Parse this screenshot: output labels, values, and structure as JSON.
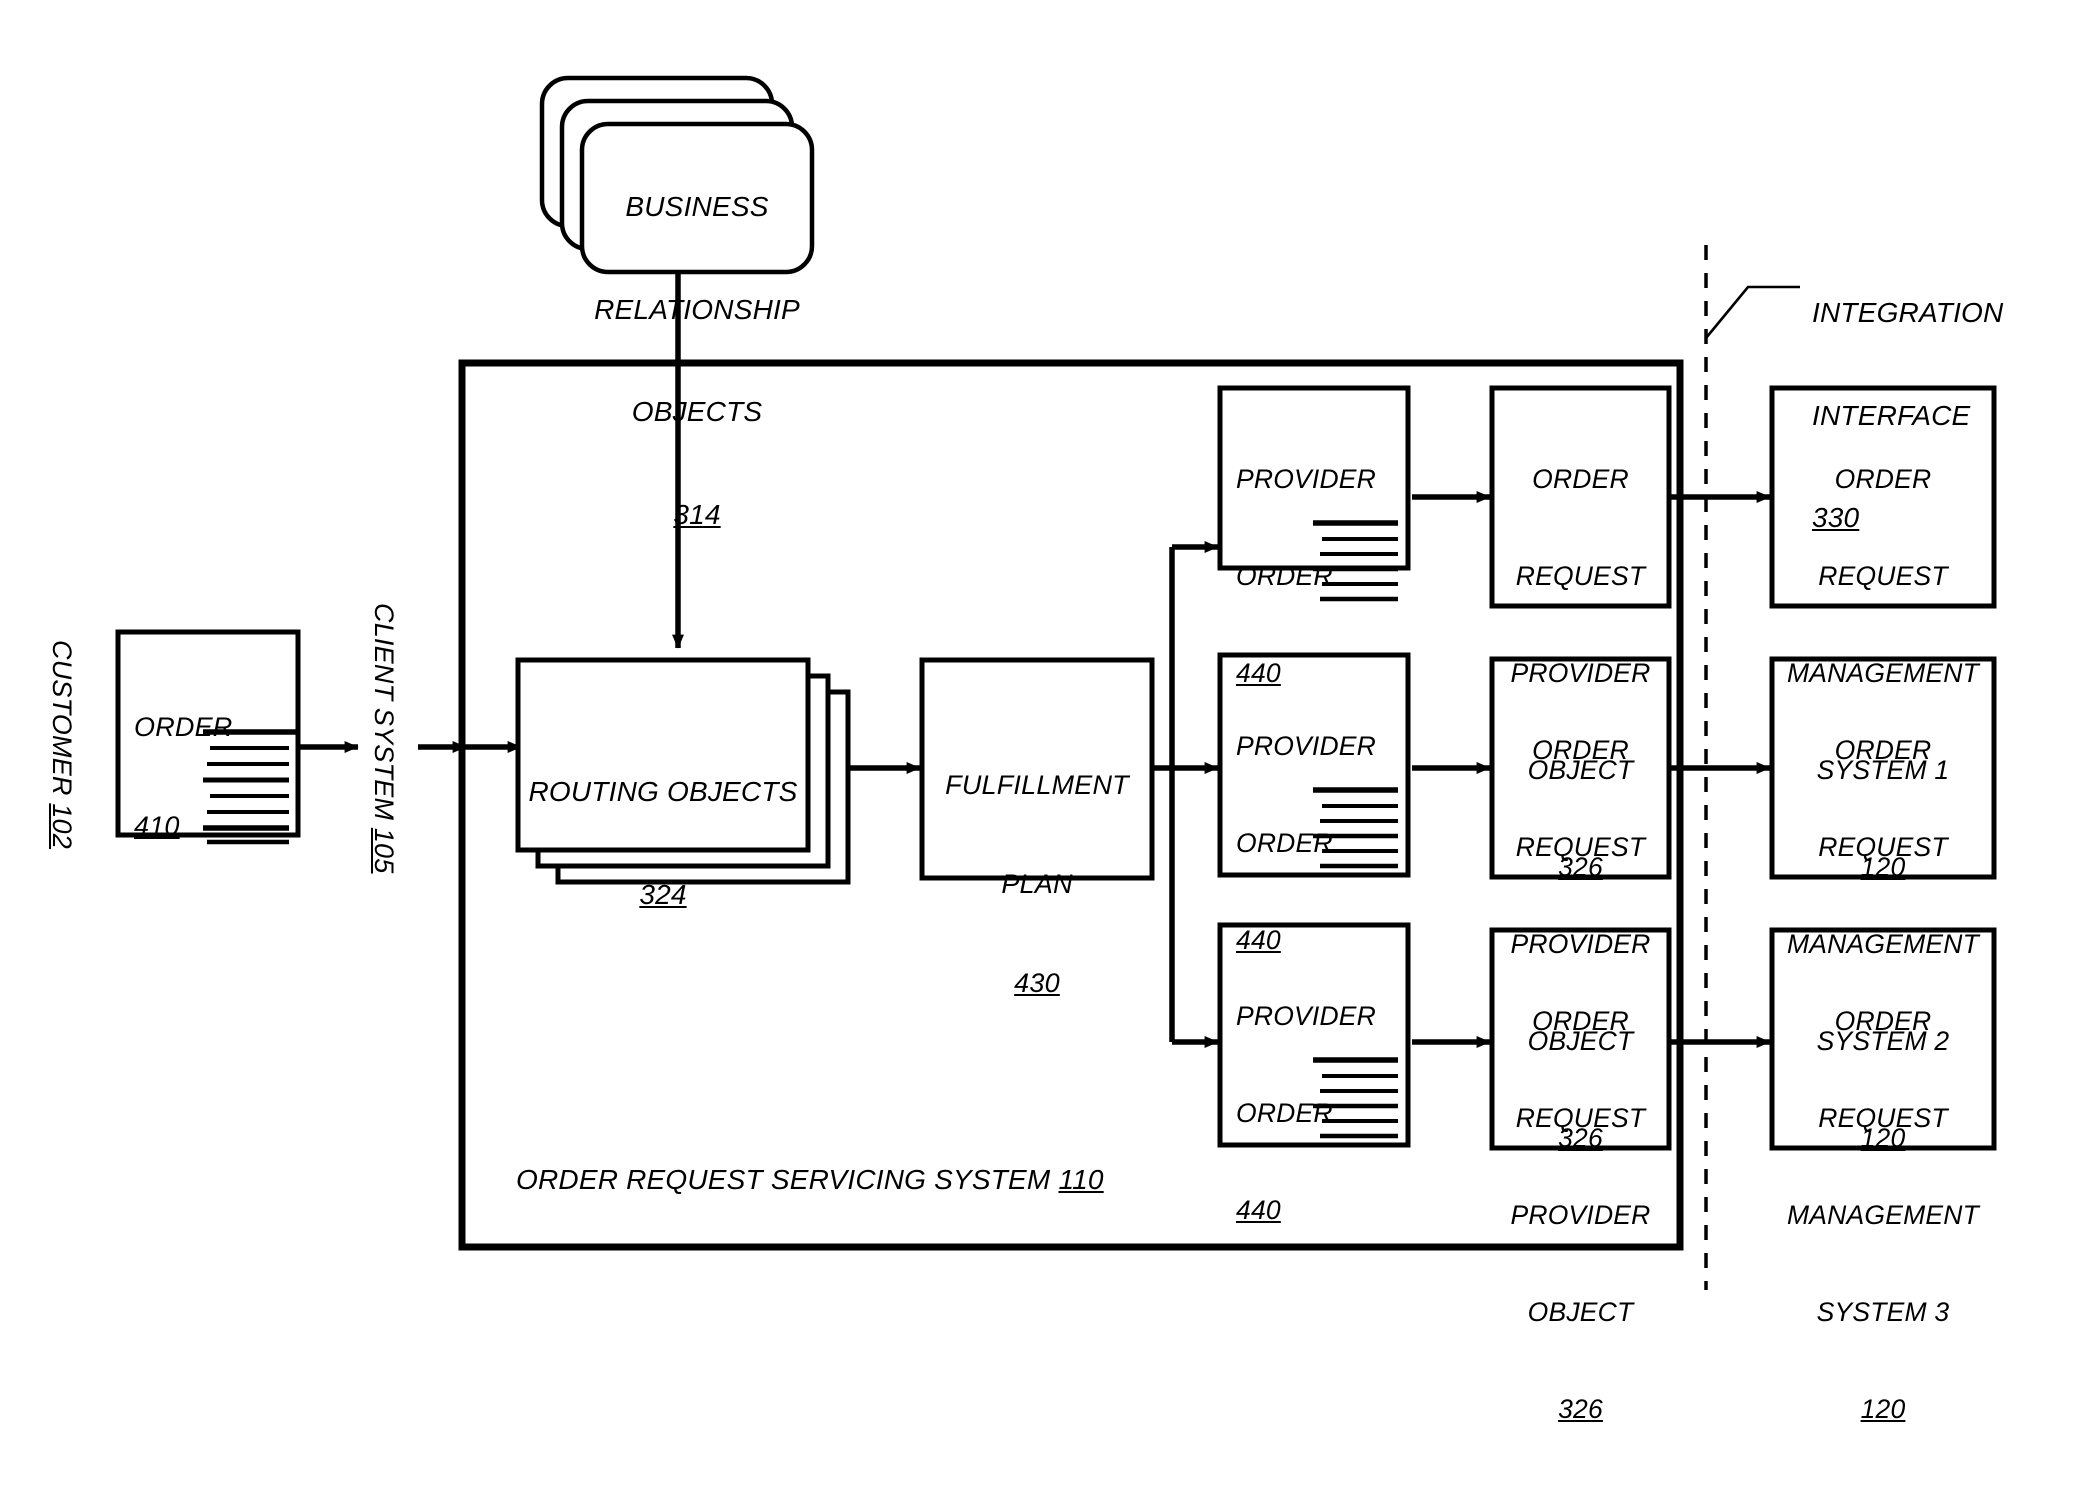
{
  "figure": {
    "type": "patent-flow-diagram",
    "background": "#ffffff",
    "stroke": "#000000"
  },
  "nodes": {
    "business_relationship_objects": {
      "lines": [
        "BUSINESS",
        "RELATIONSHIP",
        "OBJECTS"
      ],
      "ref": "314",
      "shape": "stacked-rounded-rectangle",
      "stack_count": 3
    },
    "customer": {
      "label": "CUSTOMER",
      "ref": "102",
      "orientation": "rotated-90-clockwise"
    },
    "order": {
      "label": "ORDER",
      "ref": "410",
      "shape": "document-with-lines",
      "line_count": 8
    },
    "client_system": {
      "label": "CLIENT SYSTEM",
      "ref": "105",
      "orientation": "rotated-90-clockwise"
    },
    "routing_objects": {
      "label": "ROUTING OBJECTS",
      "ref": "324",
      "shape": "stacked-rectangle",
      "stack_count": 3
    },
    "fulfillment_plan": {
      "lines": [
        "FULFILLMENT",
        "PLAN"
      ],
      "ref": "430",
      "shape": "rectangle"
    },
    "order_request_servicing_system": {
      "label": "ORDER REQUEST SERVICING SYSTEM",
      "ref": "110",
      "shape": "container-rectangle"
    },
    "integration_interface": {
      "lines": [
        "INTEGRATION",
        "INTERFACE"
      ],
      "ref": "330",
      "shape": "dashed-vertical-line-with-leader"
    }
  },
  "rows": [
    {
      "provider_order": {
        "lines": [
          "PROVIDER",
          "ORDER"
        ],
        "ref": "440",
        "line_count": 6
      },
      "order_request_provider_object": {
        "lines": [
          "ORDER",
          "REQUEST",
          "PROVIDER",
          "OBJECT"
        ],
        "ref": "326"
      },
      "order_request_management_system": {
        "lines": [
          "ORDER",
          "REQUEST",
          "MANAGEMENT",
          "SYSTEM 1"
        ],
        "ref": "120"
      }
    },
    {
      "provider_order": {
        "lines": [
          "PROVIDER",
          "ORDER"
        ],
        "ref": "440",
        "line_count": 6
      },
      "order_request_provider_object": {
        "lines": [
          "ORDER",
          "REQUEST",
          "PROVIDER",
          "OBJECT"
        ],
        "ref": "326"
      },
      "order_request_management_system": {
        "lines": [
          "ORDER",
          "REQUEST",
          "MANAGEMENT",
          "SYSTEM 2"
        ],
        "ref": "120"
      }
    },
    {
      "provider_order": {
        "lines": [
          "PROVIDER",
          "ORDER"
        ],
        "ref": "440",
        "line_count": 6
      },
      "order_request_provider_object": {
        "lines": [
          "ORDER",
          "REQUEST",
          "PROVIDER",
          "OBJECT"
        ],
        "ref": "326"
      },
      "order_request_management_system": {
        "lines": [
          "ORDER",
          "REQUEST",
          "MANAGEMENT",
          "SYSTEM 3"
        ],
        "ref": "120"
      }
    }
  ]
}
